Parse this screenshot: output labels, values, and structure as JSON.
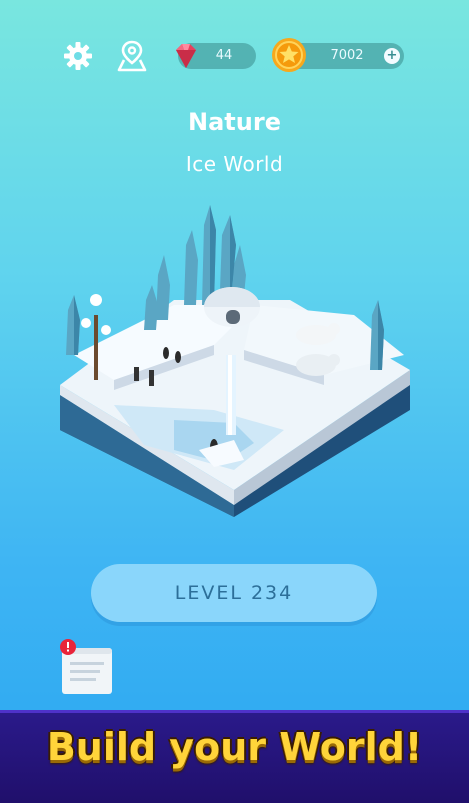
{
  "header": {
    "gems": "44",
    "coins": "7002",
    "plus": "+"
  },
  "world": {
    "category": "Nature",
    "name": "Ice World"
  },
  "level_button": "LEVEL 234",
  "banner": "Build your World!",
  "icons": {
    "settings": "gear-icon",
    "map": "map-pin-icon",
    "gem": "gem-icon",
    "coin": "coin-star-icon",
    "quest": "scroll-icon",
    "alert": "alert-badge-icon"
  },
  "colors": {
    "bg_top": "#79e6df",
    "bg_bottom": "#2aa6f2",
    "gem": "#e8405c",
    "coin": "#f7a81c",
    "banner_bg": "#200f6b",
    "banner_text": "#ffd43a"
  }
}
